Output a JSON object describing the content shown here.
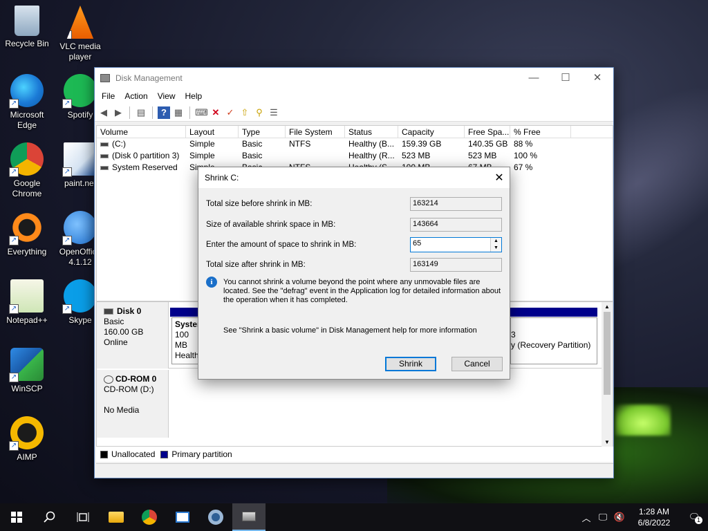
{
  "desktop": {
    "icons": [
      {
        "label": "Recycle Bin",
        "icon": "recycle-bin-icon"
      },
      {
        "label": "VLC media player",
        "icon": "vlc-icon"
      },
      {
        "label": "Microsoft Edge",
        "icon": "edge-icon"
      },
      {
        "label": "Spotify",
        "icon": "spotify-icon"
      },
      {
        "label": "Google Chrome",
        "icon": "chrome-icon"
      },
      {
        "label": "paint.net",
        "icon": "paintnet-icon"
      },
      {
        "label": "Everything",
        "icon": "everything-icon"
      },
      {
        "label": "OpenOffice 4.1.12",
        "icon": "openoffice-icon"
      },
      {
        "label": "Notepad++",
        "icon": "notepadpp-icon"
      },
      {
        "label": "Skype",
        "icon": "skype-icon"
      },
      {
        "label": "WinSCP",
        "icon": "winscp-icon"
      },
      {
        "label": "AIMP",
        "icon": "aimp-icon"
      }
    ]
  },
  "window": {
    "title": "Disk Management",
    "controls": {
      "minimize": "—",
      "maximize": "☐",
      "close": "✕"
    },
    "menu": [
      "File",
      "Action",
      "View",
      "Help"
    ],
    "columns": [
      "Volume",
      "Layout",
      "Type",
      "File System",
      "Status",
      "Capacity",
      "Free Spa...",
      "% Free"
    ],
    "rows": [
      {
        "volume": "(C:)",
        "layout": "Simple",
        "type": "Basic",
        "fs": "NTFS",
        "status": "Healthy (B...",
        "capacity": "159.39 GB",
        "free": "140.35 GB",
        "pct": "88 %"
      },
      {
        "volume": "(Disk 0 partition 3)",
        "layout": "Simple",
        "type": "Basic",
        "fs": "",
        "status": "Healthy (R...",
        "capacity": "523 MB",
        "free": "523 MB",
        "pct": "100 %"
      },
      {
        "volume": "System Reserved",
        "layout": "Simple",
        "type": "Basic",
        "fs": "NTFS",
        "status": "Healthy (S...",
        "capacity": "100 MB",
        "free": "67 MB",
        "pct": "67 %"
      }
    ],
    "disk0": {
      "name": "Disk 0",
      "type": "Basic",
      "size": "160.00 GB",
      "status": "Online",
      "part1_name": "System",
      "part1_size": "100 MB",
      "part1_status": "Healthy",
      "part3_size": "3",
      "part3_status": "y (Recovery Partition)"
    },
    "cdrom": {
      "name": "CD-ROM 0",
      "drive": "CD-ROM (D:)",
      "media": "No Media"
    },
    "legend": {
      "unallocated": "Unallocated",
      "primary": "Primary partition"
    }
  },
  "dialog": {
    "title": "Shrink C:",
    "close": "✕",
    "fields": {
      "total_before_label": "Total size before shrink in MB:",
      "total_before_value": "163214",
      "available_label": "Size of available shrink space in MB:",
      "available_value": "143664",
      "amount_label": "Enter the amount of space to shrink in MB:",
      "amount_value": "65",
      "total_after_label": "Total size after shrink in MB:",
      "total_after_value": "163149"
    },
    "info_text": "You cannot shrink a volume beyond the point where any unmovable files are located. See the \"defrag\" event in the Application log for detailed information about the operation when it has completed.",
    "help_text": "See \"Shrink a basic volume\" in Disk Management help for more information",
    "buttons": {
      "shrink": "Shrink",
      "cancel": "Cancel"
    }
  },
  "taskbar": {
    "time": "1:28 AM",
    "date": "6/8/2022",
    "notification_count": "1"
  },
  "colors": {
    "unallocated": "#000000",
    "primary_partition": "#00008b",
    "accent": "#0078d7"
  }
}
